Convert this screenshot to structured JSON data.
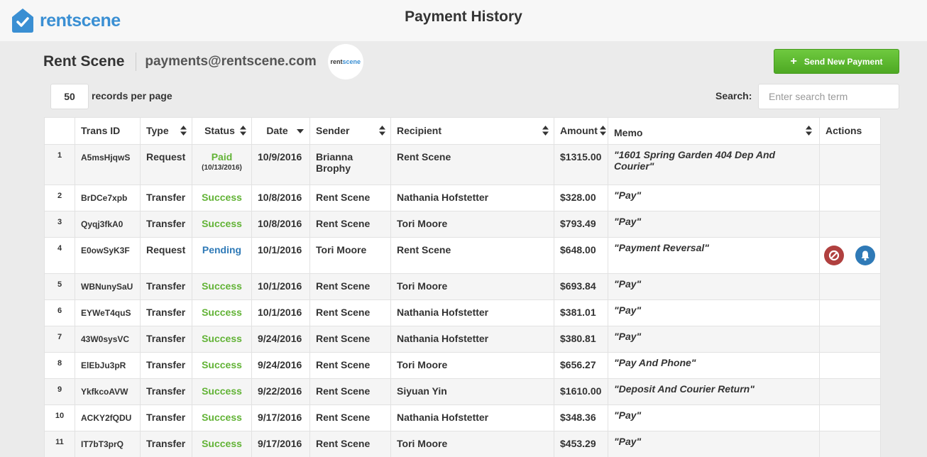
{
  "header": {
    "logo_part1": "rent",
    "logo_part2": "scene",
    "title": "Payment History"
  },
  "account": {
    "name": "Rent Scene",
    "email": "payments@rentscene.com",
    "avatar_part1": "rent",
    "avatar_part2": "scene"
  },
  "send_button": {
    "label": "Send New Payment"
  },
  "controls": {
    "per_page_value": "50",
    "per_page_label": "records per page",
    "search_label": "Search:",
    "search_placeholder": "Enter search term"
  },
  "table": {
    "columns": [
      "",
      "Trans ID",
      "Type",
      "Status",
      "Date",
      "Sender",
      "Recipient",
      "Amount",
      "Memo",
      "Actions"
    ],
    "rows": [
      {
        "num": "1",
        "id": "A5msHjqwS",
        "type": "Request",
        "status": "Paid",
        "status_sub": "(10/13/2016)",
        "date": "10/9/2016",
        "sender": "Brianna Brophy",
        "recipient": "Rent Scene",
        "amount": "$1315.00",
        "memo": "\"1601 Spring Garden 404 Dep And Courier\""
      },
      {
        "num": "2",
        "id": "BrDCe7xpb",
        "type": "Transfer",
        "status": "Success",
        "status_sub": "",
        "date": "10/8/2016",
        "sender": "Rent Scene",
        "recipient": "Nathania Hofstetter",
        "amount": "$328.00",
        "memo": "\"Pay\""
      },
      {
        "num": "3",
        "id": "Qyqj3fkA0",
        "type": "Transfer",
        "status": "Success",
        "status_sub": "",
        "date": "10/8/2016",
        "sender": "Rent Scene",
        "recipient": "Tori Moore",
        "amount": "$793.49",
        "memo": "\"Pay\""
      },
      {
        "num": "4",
        "id": "E0owSyK3F",
        "type": "Request",
        "status": "Pending",
        "status_sub": "",
        "date": "10/1/2016",
        "sender": "Tori Moore",
        "recipient": "Rent Scene",
        "amount": "$648.00",
        "memo": "\"Payment Reversal\""
      },
      {
        "num": "5",
        "id": "WBNunySaU",
        "type": "Transfer",
        "status": "Success",
        "status_sub": "",
        "date": "10/1/2016",
        "sender": "Rent Scene",
        "recipient": "Tori Moore",
        "amount": "$693.84",
        "memo": "\"Pay\""
      },
      {
        "num": "6",
        "id": "EYWeT4quS",
        "type": "Transfer",
        "status": "Success",
        "status_sub": "",
        "date": "10/1/2016",
        "sender": "Rent Scene",
        "recipient": "Nathania Hofstetter",
        "amount": "$381.01",
        "memo": "\"Pay\""
      },
      {
        "num": "7",
        "id": "43W0sysVC",
        "type": "Transfer",
        "status": "Success",
        "status_sub": "",
        "date": "9/24/2016",
        "sender": "Rent Scene",
        "recipient": "Nathania Hofstetter",
        "amount": "$380.81",
        "memo": "\"Pay\""
      },
      {
        "num": "8",
        "id": "ElEbJu3pR",
        "type": "Transfer",
        "status": "Success",
        "status_sub": "",
        "date": "9/24/2016",
        "sender": "Rent Scene",
        "recipient": "Tori Moore",
        "amount": "$656.27",
        "memo": "\"Pay And Phone\""
      },
      {
        "num": "9",
        "id": "YkfkcoAVW",
        "type": "Transfer",
        "status": "Success",
        "status_sub": "",
        "date": "9/22/2016",
        "sender": "Rent Scene",
        "recipient": "Siyuan Yin",
        "amount": "$1610.00",
        "memo": "\"Deposit And Courier Return\""
      },
      {
        "num": "10",
        "id": "ACKY2fQDU",
        "type": "Transfer",
        "status": "Success",
        "status_sub": "",
        "date": "9/17/2016",
        "sender": "Rent Scene",
        "recipient": "Nathania Hofstetter",
        "amount": "$348.36",
        "memo": "\"Pay\""
      },
      {
        "num": "11",
        "id": "IT7bT3prQ",
        "type": "Transfer",
        "status": "Success",
        "status_sub": "",
        "date": "9/17/2016",
        "sender": "Rent Scene",
        "recipient": "Tori Moore",
        "amount": "$453.29",
        "memo": "\"Pay\""
      }
    ]
  },
  "colors": {
    "success": "#62b336",
    "pending": "#2f7ab7",
    "cancel": "#b0403f",
    "brand": "#3a8fd3"
  }
}
